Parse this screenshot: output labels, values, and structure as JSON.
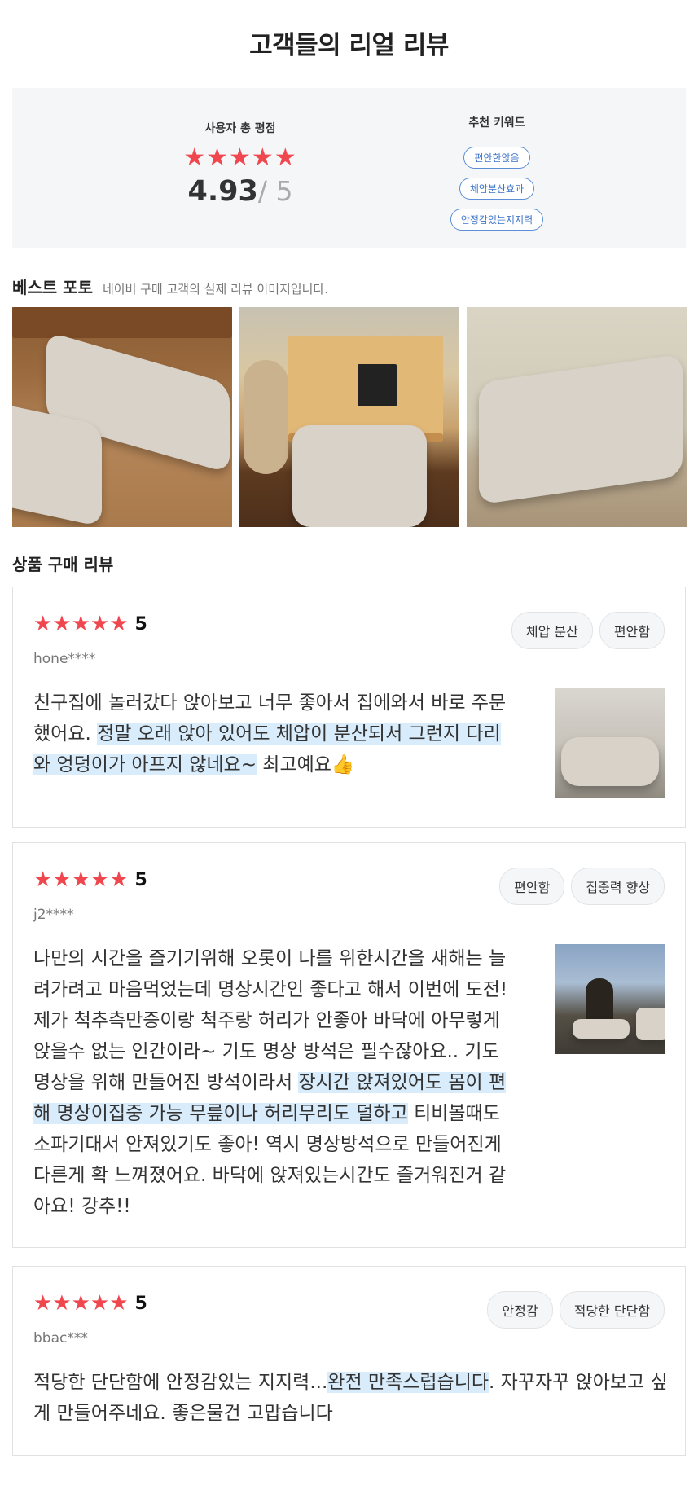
{
  "page_title": "고객들의 리얼 리뷰",
  "summary": {
    "rating_label": "사용자 총 평점",
    "stars": "★★★★★",
    "score": "4.93",
    "score_max": "/ 5",
    "keywords_label": "추천 키워드",
    "keywords": [
      "편안한앉음",
      "체압분산효과",
      "안정감있는지지력"
    ]
  },
  "best_photos": {
    "title": "베스트 포토",
    "subtitle": "네이버 구매 고객의 실제 리뷰 이미지입니다."
  },
  "reviews_section_title": "상품 구매 리뷰",
  "colors": {
    "star": "#f0474f",
    "highlight": "#d9ecfb",
    "chip_border": "#5b8ed6"
  },
  "reviews": [
    {
      "stars": "★★★★★",
      "rating": "5",
      "user": "hone****",
      "tags": [
        "체압 분산",
        "편안함"
      ],
      "text_before": "친구집에 놀러갔다 앉아보고 너무 좋아서 집에와서 바로 주문했어요. ",
      "text_highlight": "정말 오래 앉아 있어도 체압이 분산되서 그런지 다리와 엉덩이가 아프지 않네요~",
      "text_after": " 최고예요👍"
    },
    {
      "stars": "★★★★★",
      "rating": "5",
      "user": "j2****",
      "tags": [
        "편안함",
        "집중력 향상"
      ],
      "text_before": "나만의 시간을 즐기기위해 오롯이 나를 위한시간을 새해는 늘려가려고 마음먹었는데 명상시간인 좋다고 해서 이번에 도전! 제가 척추측만증이랑 척주랑 허리가 안좋아 바닥에 아무렇게 앉을수 없는 인간이라~ 기도 명상 방석은 필수잖아요.. 기도 명상을 위해 만들어진 방석이라서 ",
      "text_highlight": "장시간 앉져있어도 몸이 편해 명상이집중 가능 무릎이나 허리무리도 덜하고",
      "text_after": " 티비볼때도 소파기대서 안져있기도 좋아! 역시 명상방석으로 만들어진게 다른게 확 느껴졌어요. 바닥에 앉져있는시간도 즐거워진거 같아요! 강추!!"
    },
    {
      "stars": "★★★★★",
      "rating": "5",
      "user": "bbac***",
      "tags": [
        "안정감",
        "적당한 단단함"
      ],
      "text_before": "적당한 단단함에 안정감있는 지지력...",
      "text_highlight": "완전 만족스럽습니다",
      "text_after": ". 자꾸자꾸 앉아보고 싶게 만들어주네요. 좋은물건 고맙습니다"
    }
  ]
}
